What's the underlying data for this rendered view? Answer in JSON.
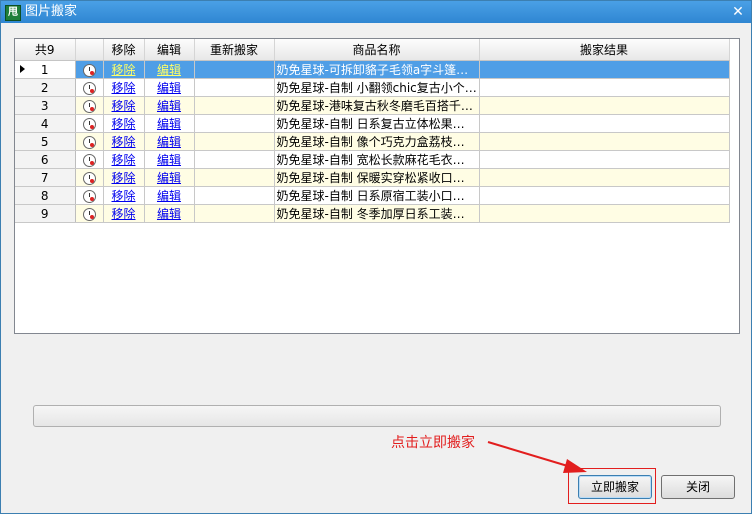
{
  "window": {
    "title": "图片搬家",
    "app_icon_text": "甩"
  },
  "table": {
    "headers": {
      "count": "共9",
      "remove": "移除",
      "edit": "编辑",
      "remove_again": "重新搬家",
      "product_name": "商品名称",
      "result": "搬家结果"
    },
    "rows": [
      {
        "num": "1",
        "remove": "移除",
        "edit": "编辑",
        "name": "奶免星球-可拆卸貉子毛领a字斗篷…",
        "result": "",
        "selected": true
      },
      {
        "num": "2",
        "remove": "移除",
        "edit": "编辑",
        "name": "奶免星球-自制 小翻领chic复古小个…",
        "result": ""
      },
      {
        "num": "3",
        "remove": "移除",
        "edit": "编辑",
        "name": "奶免星球-港味复古秋冬磨毛百搭千…",
        "result": ""
      },
      {
        "num": "4",
        "remove": "移除",
        "edit": "编辑",
        "name": "奶免星球-自制 日系复古立体松果…",
        "result": ""
      },
      {
        "num": "5",
        "remove": "移除",
        "edit": "编辑",
        "name": "奶免星球-自制 像个巧克力盒荔枝…",
        "result": ""
      },
      {
        "num": "6",
        "remove": "移除",
        "edit": "编辑",
        "name": "奶免星球-自制 宽松长款麻花毛衣…",
        "result": ""
      },
      {
        "num": "7",
        "remove": "移除",
        "edit": "编辑",
        "name": "奶免星球-自制 保暖实穿松紧收口…",
        "result": ""
      },
      {
        "num": "8",
        "remove": "移除",
        "edit": "编辑",
        "name": "奶免星球-自制 日系原宿工装小口…",
        "result": ""
      },
      {
        "num": "9",
        "remove": "移除",
        "edit": "编辑",
        "name": "奶免星球-自制 冬季加厚日系工装…",
        "result": ""
      }
    ]
  },
  "progress": {
    "value": 0
  },
  "annotation": {
    "text": "点击立即搬家",
    "color": "#e21e1e"
  },
  "buttons": {
    "start": "立即搬家",
    "close": "关闭"
  }
}
